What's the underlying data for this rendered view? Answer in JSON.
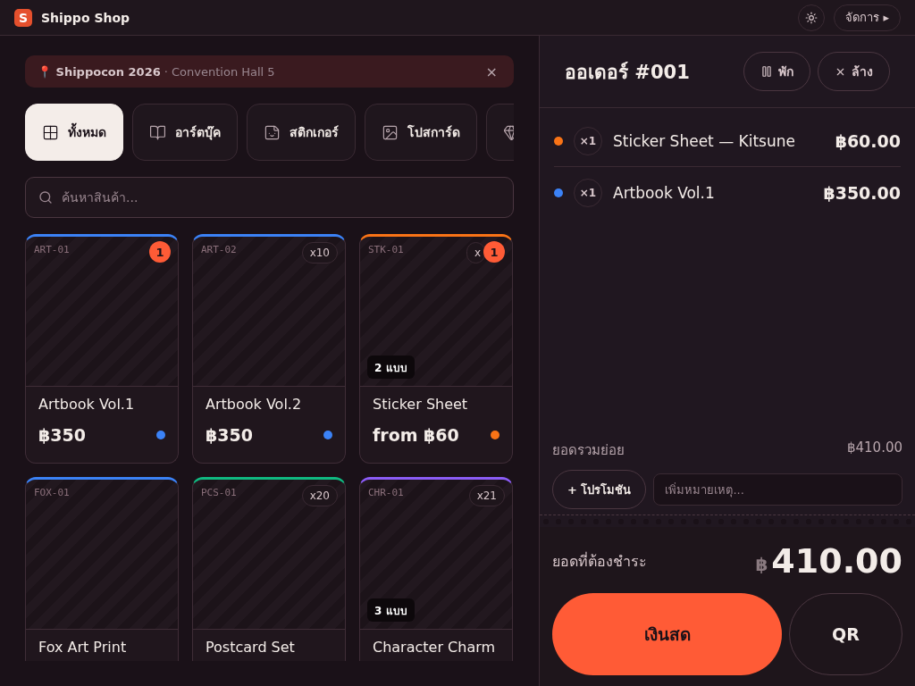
{
  "app": {
    "title": "Shippo Shop",
    "logo": "S",
    "menu_button": "จัดการ ▸"
  },
  "banner": {
    "event": "📍 Shippocon 2026",
    "venue": "· Convention Hall 5",
    "close": "×"
  },
  "categories": [
    {
      "label": "ทั้งหมด",
      "selected": true
    },
    {
      "label": "อาร์ตบุ๊ค",
      "selected": false
    },
    {
      "label": "สติกเกอร์",
      "selected": false
    },
    {
      "label": "โปสการ์ด",
      "selected": false
    },
    {
      "selected": false
    }
  ],
  "search": {
    "placeholder": "ค้นหาสินค้า..."
  },
  "products": [
    {
      "code": "ART-01",
      "count": "1",
      "name": "Artbook Vol.1",
      "price": "฿350",
      "color": "#3b82f6"
    },
    {
      "code": "ART-02",
      "stock": "x10",
      "name": "Artbook Vol.2",
      "price": "฿350",
      "color": "#3b82f6"
    },
    {
      "code": "STK-01",
      "stock": "x",
      "count": "1",
      "variants": "2 แบบ",
      "name": "Sticker Sheet",
      "price": "from ฿60",
      "color": "#f97316"
    },
    {
      "code": "FOX-01",
      "name": "Fox Art Print",
      "color": "#3b82f6"
    },
    {
      "code": "PCS-01",
      "stock": "x20",
      "name": "Postcard Set",
      "color": "#10b981"
    },
    {
      "code": "CHR-01",
      "stock": "x21",
      "variants": "3 แบบ",
      "name": "Character Charm",
      "color": "#8b5cf6"
    }
  ],
  "order": {
    "title": "ออเดอร์ #001",
    "hold_button": "พัก",
    "clear_button": "ล้าง",
    "items": [
      {
        "qty": "×1",
        "name": "Sticker Sheet — Kitsune",
        "price": "฿60.00",
        "color": "#f97316"
      },
      {
        "qty": "×1",
        "name": "Artbook Vol.1",
        "price": "฿350.00",
        "color": "#3b82f6"
      }
    ],
    "subtotal_label": "ยอดรวมย่อย",
    "subtotal": "฿410.00",
    "promo_button": "+ โปรโมชัน",
    "note_placeholder": "เพิ่มหมายเหตุ...",
    "total_label": "ยอดที่ต้องชำระ",
    "currency": "฿",
    "total": "410.00",
    "cash_button": "เงินสด",
    "qr_button": "QR"
  }
}
